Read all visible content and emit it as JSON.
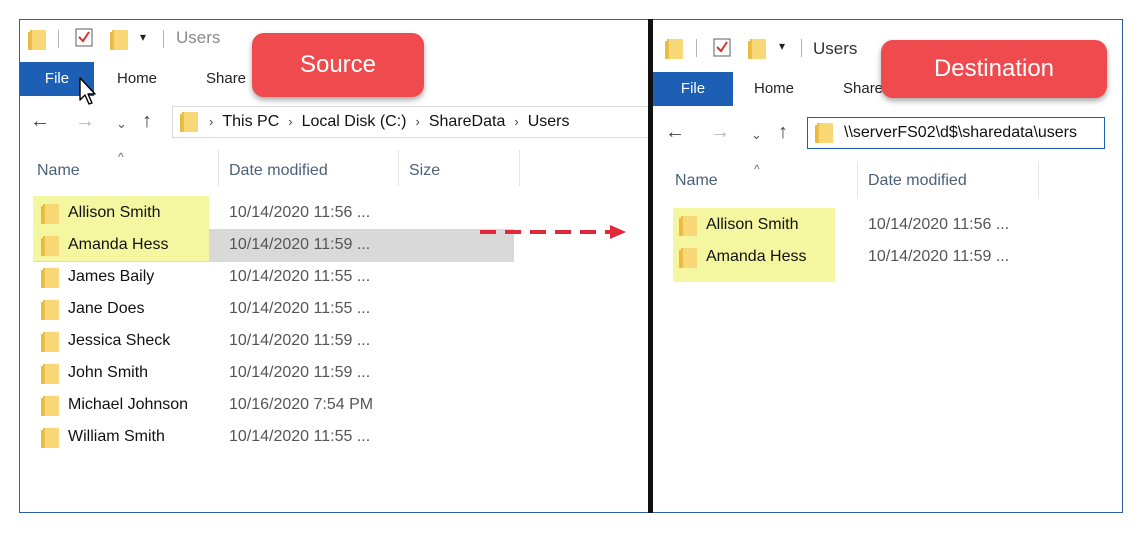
{
  "source": {
    "title": "Users",
    "tabs": {
      "file": "File",
      "home": "Home",
      "share": "Share"
    },
    "breadcrumb": [
      "This PC",
      "Local Disk (C:)",
      "ShareData",
      "Users"
    ],
    "columns": {
      "name": "Name",
      "date": "Date modified",
      "size": "Size"
    },
    "rows": [
      {
        "name": "Allison Smith",
        "date": "10/14/2020 11:56 ..."
      },
      {
        "name": "Amanda Hess",
        "date": "10/14/2020 11:59 ..."
      },
      {
        "name": "James Baily",
        "date": "10/14/2020 11:55 ..."
      },
      {
        "name": "Jane Does",
        "date": "10/14/2020 11:55 ..."
      },
      {
        "name": "Jessica Sheck",
        "date": "10/14/2020 11:59 ..."
      },
      {
        "name": "John Smith",
        "date": "10/14/2020 11:59 ..."
      },
      {
        "name": "Michael Johnson",
        "date": "10/16/2020 7:54 PM"
      },
      {
        "name": "William Smith",
        "date": "10/14/2020 11:55 ..."
      }
    ],
    "callout": "Source"
  },
  "destination": {
    "title": "Users",
    "tabs": {
      "file": "File",
      "home": "Home",
      "share": "Share"
    },
    "address": "\\\\serverFS02\\d$\\sharedata\\users",
    "columns": {
      "name": "Name",
      "date": "Date modified"
    },
    "rows": [
      {
        "name": "Allison Smith",
        "date": "10/14/2020 11:56 ..."
      },
      {
        "name": "Amanda Hess",
        "date": "10/14/2020 11:59 ..."
      }
    ],
    "callout": "Destination"
  },
  "colors": {
    "accent": "#1c5fb4",
    "callout": "#ef4a4d",
    "highlight": "#f4f7a0",
    "arrow": "#e0283a"
  }
}
